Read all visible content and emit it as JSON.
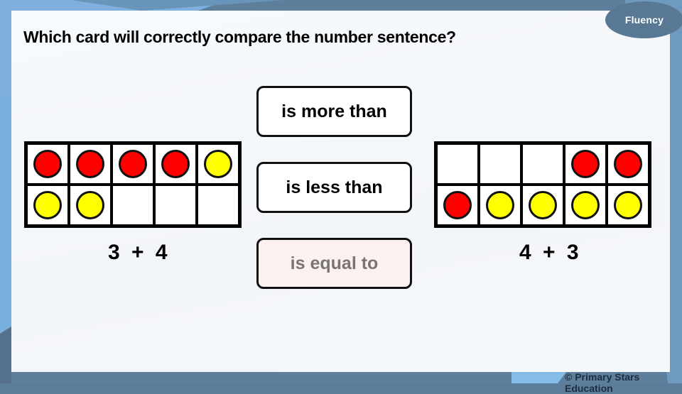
{
  "badge": {
    "label": "Fluency"
  },
  "question": "Which card will correctly compare the number sentence?",
  "colors": {
    "red": "#ff0000",
    "yellow": "#ffff00",
    "badge": "#587893",
    "dim_card_bg": "#fcf1f1"
  },
  "left_frame": {
    "cells": [
      "red",
      "red",
      "red",
      "red",
      "yellow",
      "yellow",
      "yellow",
      "empty",
      "empty",
      "empty"
    ],
    "expression": "3 + 4"
  },
  "right_frame": {
    "cells": [
      "empty",
      "empty",
      "empty",
      "red",
      "red",
      "red",
      "yellow",
      "yellow",
      "yellow",
      "yellow"
    ],
    "expression": "4 + 3"
  },
  "cards": [
    {
      "label": "is more than",
      "state": "normal"
    },
    {
      "label": "is less than",
      "state": "normal"
    },
    {
      "label": "is equal to",
      "state": "dimmed"
    }
  ],
  "footer": {
    "copyright": "© Primary Stars Education"
  }
}
